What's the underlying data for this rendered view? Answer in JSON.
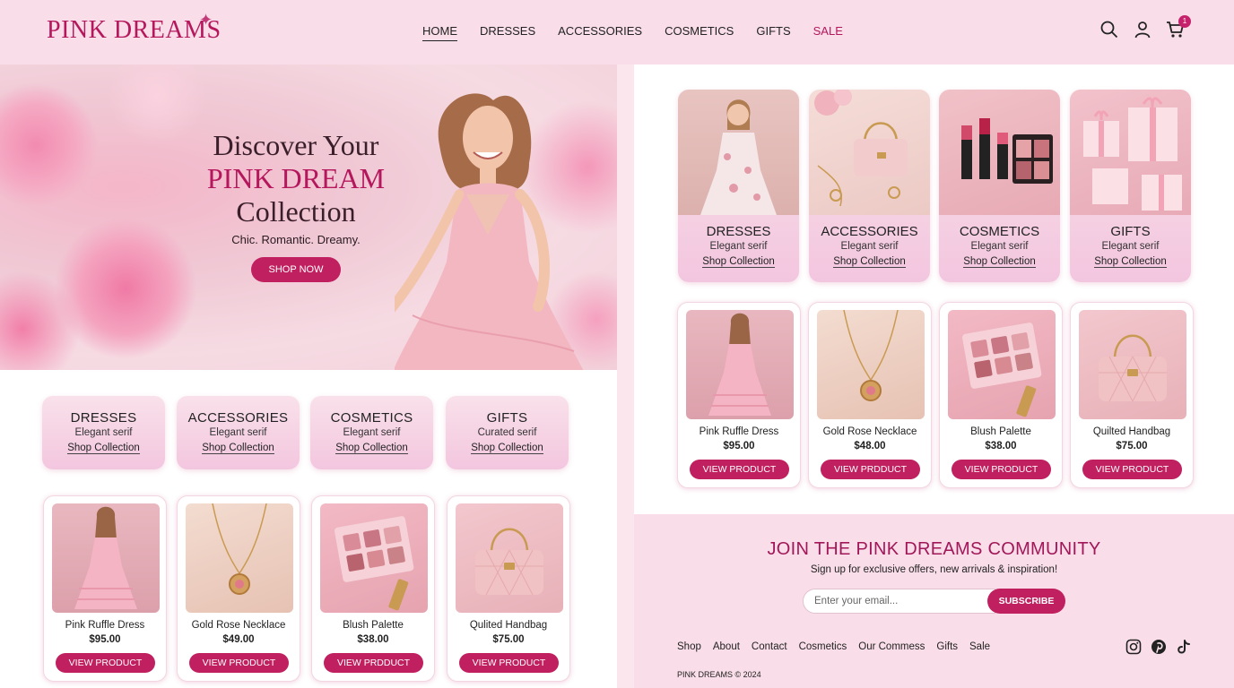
{
  "header": {
    "logo": "PINK DREAMS",
    "nav": [
      "HOME",
      "DRESSES",
      "ACCESSORIES",
      "COSMETICS",
      "GIFTS",
      "SALE"
    ],
    "cart_count": "1",
    "icons": [
      "search-icon",
      "user-icon",
      "cart-icon"
    ]
  },
  "hero": {
    "title_line1": "Discover Your",
    "title_line2": "PINK DREAM",
    "title_line3": "Collection",
    "subtitle": "Chic. Romantic. Dreamy.",
    "cta": "SHOP NOW"
  },
  "left_categories": [
    {
      "title": "DRESSES",
      "sub": "Elegant serif",
      "link": "Shop Collection"
    },
    {
      "title": "ACCESSORIES",
      "sub": "Elegant serif",
      "link": "Shop Collection"
    },
    {
      "title": "COSMETICS",
      "sub": "Elegant serif",
      "link": "Shop Collection"
    },
    {
      "title": "GIFTS",
      "sub": "Curated serif",
      "link": "Shop Collection"
    }
  ],
  "left_products": [
    {
      "name": "Pink Ruffle Dress",
      "price": "$95.00",
      "button": "VIEW PRODUCT"
    },
    {
      "name": "Gold Rose Necklace",
      "price": "$49.00",
      "button": "VIEW PRODUCT"
    },
    {
      "name": "Blush Palette",
      "price": "$38.00",
      "button": "VIEW PRDDUCT"
    },
    {
      "name": "Qulited Handbag",
      "price": "$75.00",
      "button": "VIEW PRODUCT"
    }
  ],
  "right_categories": [
    {
      "title": "DRESSES",
      "sub": "Elegant serif",
      "link": "Shop Collection"
    },
    {
      "title": "ACCESSORIES",
      "sub": "Elegant serif",
      "link": "Shop Collection"
    },
    {
      "title": "COSMETICS",
      "sub": "Elegant serif",
      "link": "Shop Collection"
    },
    {
      "title": "GIFTS",
      "sub": "Elegant serif",
      "link": "Shop Collection"
    }
  ],
  "right_products": [
    {
      "name": "Pink Ruffle Dress",
      "price": "$95.00",
      "button": "VIEW PRODUCT"
    },
    {
      "name": "Gold Rose Necklace",
      "price": "$48.00",
      "button": "VIEW PRDDUCT"
    },
    {
      "name": "Blush Palette",
      "price": "$38.00",
      "button": "VIEW PRODUCT"
    },
    {
      "name": "Quilted Handbag",
      "price": "$75.00",
      "button": "VIEW PRODUCT"
    }
  ],
  "community": {
    "title": "JOIN THE PINK DREAMS COMMUNITY",
    "subtitle": "Sign up for exclusive offers, new arrivals & inspiration!",
    "email_placeholder": "Enter your email...",
    "subscribe": "SUBSCRIBE"
  },
  "footer": {
    "links": [
      "Shop",
      "About",
      "Contact",
      "Cosmetics",
      "Our Commess",
      "Gifts",
      "Sale"
    ],
    "copyright": "PINK DREAMS © 2024",
    "socials": [
      "instagram-icon",
      "pinterest-icon",
      "tiktok-icon"
    ]
  },
  "colors": {
    "accent": "#c0205f",
    "brand": "#b5175d",
    "background": "#f9dde8"
  }
}
